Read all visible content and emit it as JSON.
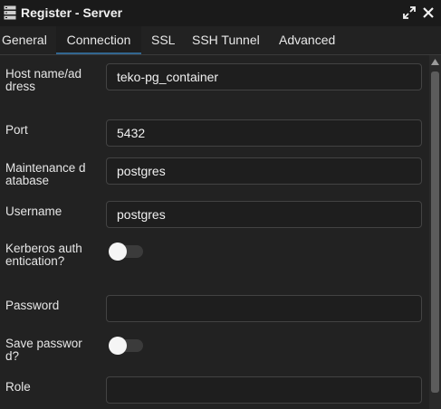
{
  "window": {
    "title": "Register - Server",
    "title_icon": "server-icon",
    "expand_icon": "expand-icon",
    "close_icon": "close-icon"
  },
  "tabs": [
    {
      "label": "General",
      "active": false
    },
    {
      "label": "Connection",
      "active": true
    },
    {
      "label": "SSL",
      "active": false
    },
    {
      "label": "SSH Tunnel",
      "active": false
    },
    {
      "label": "Advanced",
      "active": false
    }
  ],
  "form": {
    "host": {
      "label": "Host name/address",
      "value": "teko-pg_container"
    },
    "port": {
      "label": "Port",
      "value": "5432"
    },
    "maintenance_db": {
      "label": "Maintenance database",
      "value": "postgres"
    },
    "username": {
      "label": "Username",
      "value": "postgres"
    },
    "kerberos": {
      "label": "Kerberos authentication?",
      "enabled": false
    },
    "password": {
      "label": "Password",
      "value": ""
    },
    "save_password": {
      "label": "Save password?",
      "enabled": false
    },
    "role": {
      "label": "Role",
      "value": ""
    }
  },
  "colors": {
    "background": "#222222",
    "titlebar": "#1a1a1a",
    "input_bg": "#1e1e1e",
    "input_border": "#434343",
    "active_tab_underline": "#326690",
    "text": "#e6e6e6"
  }
}
